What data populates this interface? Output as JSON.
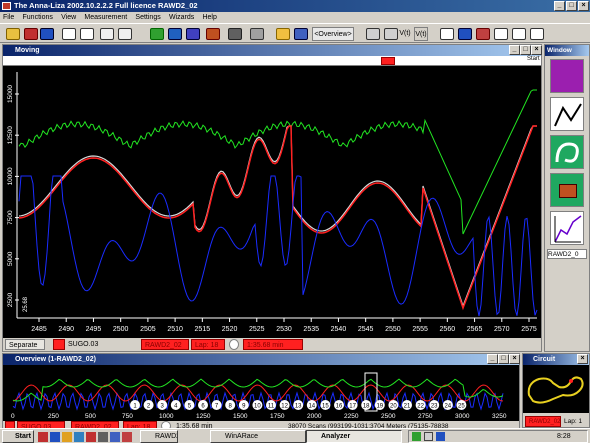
{
  "app": {
    "title": "The Anna-Liza 2002.10.2.2.2   Full licence   RAWD2_02"
  },
  "menu": [
    "File",
    "Functions",
    "View",
    "Measurement",
    "Settings",
    "Wizards",
    "Help"
  ],
  "toolbar": {
    "overview_label": "<Overview>",
    "v_label": "V(t)",
    "v2_label": "V(t)"
  },
  "moving": {
    "title": "Moving",
    "marker_strip_start": "Start",
    "y_ticks": [
      "15000",
      "12500",
      "10000",
      "7500",
      "5000",
      "2500"
    ],
    "x_ticks": [
      "2485",
      "2490",
      "2495",
      "2500",
      "2505",
      "2510",
      "2515",
      "2520",
      "2525",
      "2530",
      "2535",
      "2540",
      "2545",
      "2550",
      "2555",
      "2560",
      "2565",
      "2570",
      "2575"
    ],
    "x_label_left": "25.68",
    "status": {
      "separate": "Separate",
      "track": "SUGO.03",
      "file": "RAWD2_02",
      "lap": "Lap: 18",
      "time": "1:35.68 min"
    }
  },
  "sidebar": {
    "title": "Window",
    "file_label": "RAWD2_0",
    "icons": [
      "driver-icon",
      "speed-vs-icon",
      "circuit-icon",
      "ecu-icon",
      "chart-icon"
    ]
  },
  "overview": {
    "title": "Overview (1-RAWD2_02)",
    "x_ticks": [
      "0",
      "250",
      "500",
      "750",
      "1000",
      "1250",
      "1500",
      "1750",
      "2000",
      "2250",
      "2500",
      "2750",
      "3000",
      "3250"
    ],
    "lap_markers": [
      "1",
      "2",
      "3",
      "4",
      "5",
      "6",
      "7",
      "8",
      "9",
      "10",
      "11",
      "12",
      "13",
      "14",
      "15",
      "16",
      "17",
      "18",
      "19",
      "20",
      "21",
      "22",
      "23",
      "24",
      "25"
    ],
    "status": {
      "track": "SUGO.03",
      "file": "RAWD2_02",
      "lap": "Lap: 18",
      "time": "1:35.68 min",
      "scans": "38070 Scans (993199-1031:3704 Meters (75135-78838"
    }
  },
  "circuit": {
    "title": "Circuit",
    "file": "RAWD2_02",
    "lap": "Lap: 1"
  },
  "taskbar": {
    "start": "Start",
    "buttons": [
      "RAWD2_0",
      "WinARace",
      "Analyzer"
    ],
    "clock": "8:28"
  },
  "colors": {
    "green": "#22e522",
    "red": "#ff2020",
    "blue": "#1a2cff",
    "white": "#d8d8d8"
  }
}
